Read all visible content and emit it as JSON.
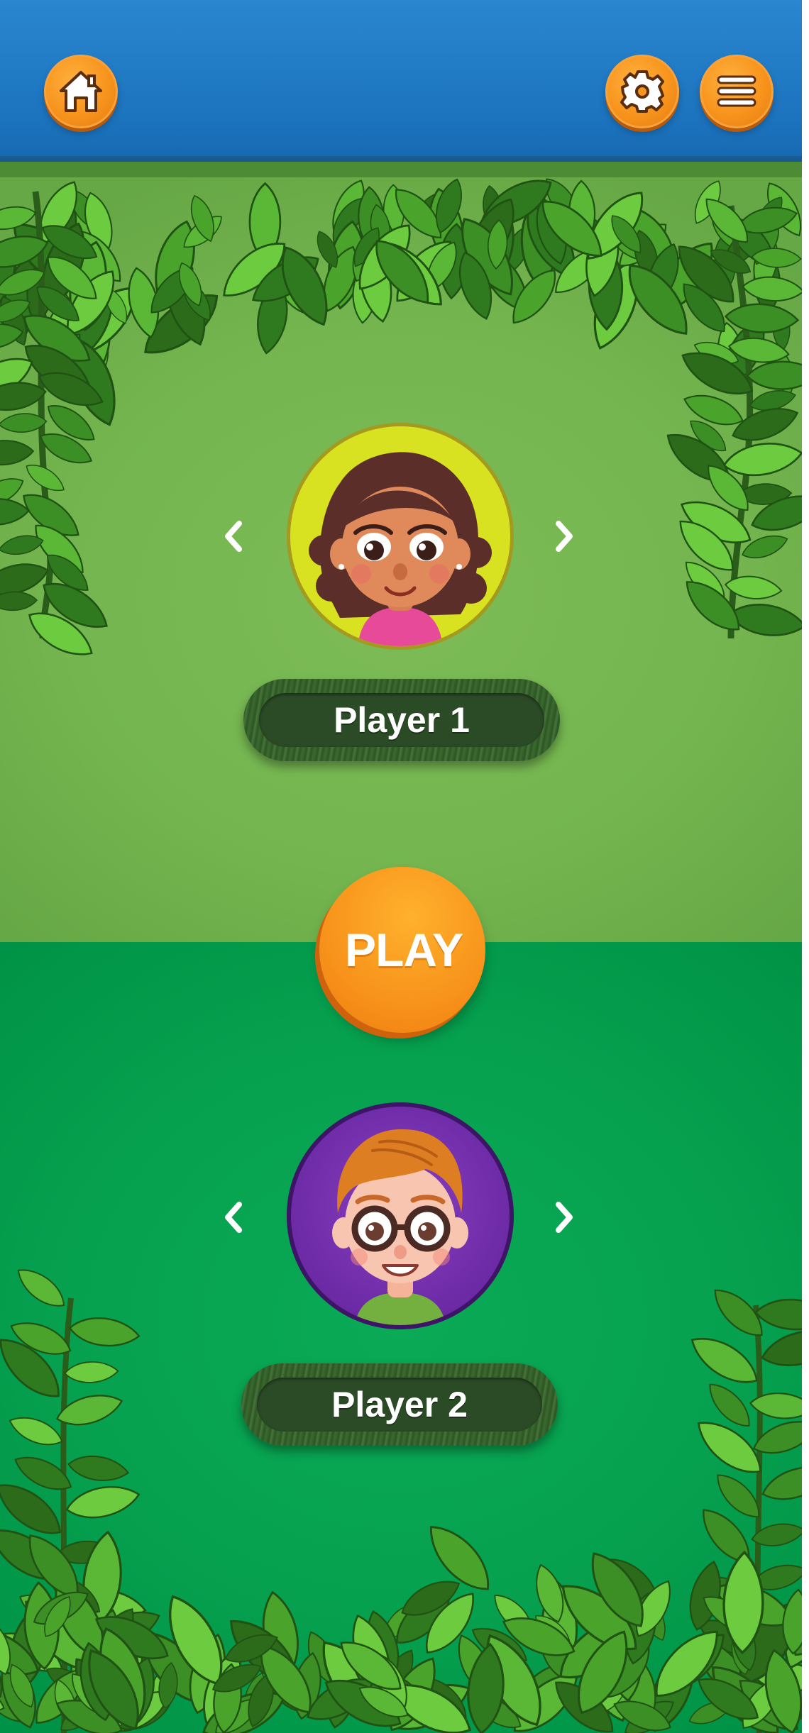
{
  "header": {
    "home_icon": "home-icon",
    "settings_icon": "gear-icon",
    "menu_icon": "hamburger-menu-icon"
  },
  "player1": {
    "name": "Player 1",
    "avatar": "girl-curly-hair-avatar",
    "avatar_ring_color": "#d9e221"
  },
  "player2": {
    "name": "Player 2",
    "avatar": "boy-glasses-avatar",
    "avatar_ring_color": "#6c2aa5"
  },
  "play_button": {
    "label": "PLAY"
  },
  "colors": {
    "header": "#1f78c2",
    "upper_panel": "#74b54f",
    "lower_panel": "#06a14f",
    "accent_orange": "#f7941d",
    "name_plate": "#2b4b26"
  }
}
